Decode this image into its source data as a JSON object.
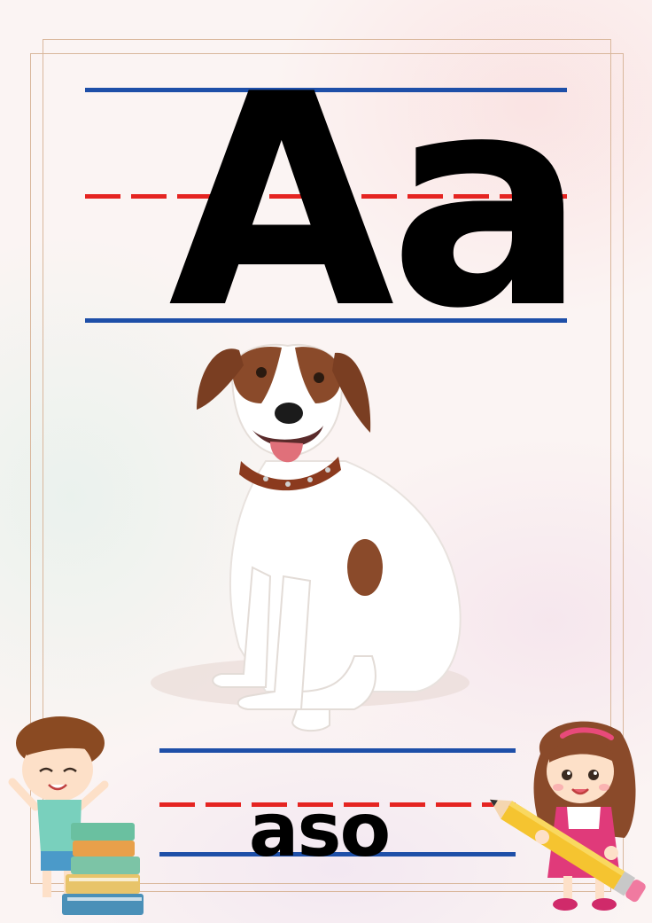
{
  "card": {
    "letters": "Aa",
    "word": "aso"
  },
  "colors": {
    "guide_blue": "#1e4fa8",
    "guide_red": "#e52421",
    "frame": "#d9b79c"
  },
  "illustrations": {
    "main": "dog-illustration",
    "bottom_left": "boy-with-books-illustration",
    "bottom_right": "girl-with-pencil-illustration"
  }
}
